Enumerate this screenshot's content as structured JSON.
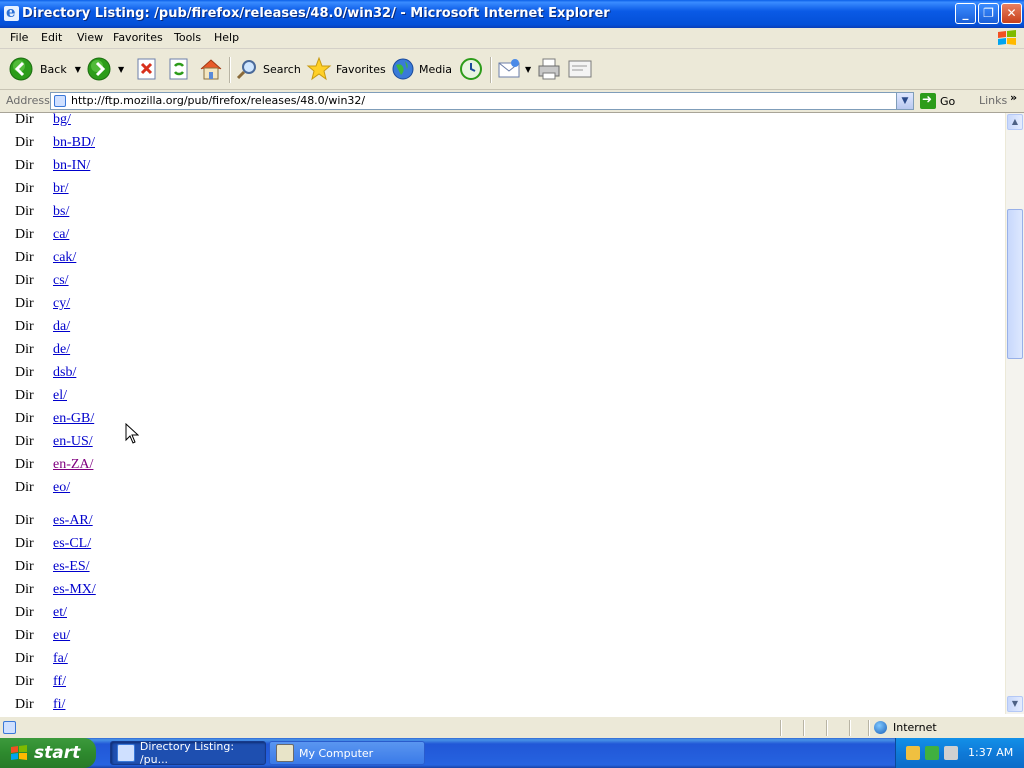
{
  "window": {
    "title": "Directory Listing: /pub/firefox/releases/48.0/win32/ - Microsoft Internet Explorer",
    "minimize_glyph": "_",
    "maximize_glyph": "❐",
    "close_glyph": "✕"
  },
  "menu": {
    "items": [
      "File",
      "Edit",
      "View",
      "Favorites",
      "Tools",
      "Help"
    ]
  },
  "toolbar": {
    "back_label": "Back",
    "search_label": "Search",
    "favorites_label": "Favorites",
    "media_label": "Media"
  },
  "address": {
    "label": "Address",
    "url": "http://ftp.mozilla.org/pub/firefox/releases/48.0/win32/",
    "go_label": "Go",
    "links_label": "Links",
    "links_chevron": "»"
  },
  "listing": {
    "rows": [
      {
        "type": "Dir",
        "name": "bg/",
        "visited": false
      },
      {
        "type": "Dir",
        "name": "bn-BD/",
        "visited": false
      },
      {
        "type": "Dir",
        "name": "bn-IN/",
        "visited": false
      },
      {
        "type": "Dir",
        "name": "br/",
        "visited": false
      },
      {
        "type": "Dir",
        "name": "bs/",
        "visited": false
      },
      {
        "type": "Dir",
        "name": "ca/",
        "visited": false
      },
      {
        "type": "Dir",
        "name": "cak/",
        "visited": false
      },
      {
        "type": "Dir",
        "name": "cs/",
        "visited": false
      },
      {
        "type": "Dir",
        "name": "cy/",
        "visited": false
      },
      {
        "type": "Dir",
        "name": "da/",
        "visited": false
      },
      {
        "type": "Dir",
        "name": "de/",
        "visited": false
      },
      {
        "type": "Dir",
        "name": "dsb/",
        "visited": false
      },
      {
        "type": "Dir",
        "name": "el/",
        "visited": false
      },
      {
        "type": "Dir",
        "name": "en-GB/",
        "visited": false
      },
      {
        "type": "Dir",
        "name": "en-US/",
        "visited": false
      },
      {
        "type": "Dir",
        "name": "en-ZA/",
        "visited": true
      },
      {
        "type": "Dir",
        "name": "eo/",
        "visited": false
      },
      {
        "type": "Dir",
        "name": "es-AR/",
        "visited": false
      },
      {
        "type": "Dir",
        "name": "es-CL/",
        "visited": false
      },
      {
        "type": "Dir",
        "name": "es-ES/",
        "visited": false
      },
      {
        "type": "Dir",
        "name": "es-MX/",
        "visited": false
      },
      {
        "type": "Dir",
        "name": "et/",
        "visited": false
      },
      {
        "type": "Dir",
        "name": "eu/",
        "visited": false
      },
      {
        "type": "Dir",
        "name": "fa/",
        "visited": false
      },
      {
        "type": "Dir",
        "name": "ff/",
        "visited": false
      },
      {
        "type": "Dir",
        "name": "fi/",
        "visited": false
      }
    ]
  },
  "scrollbar": {
    "up_glyph": "▲",
    "down_glyph": "▼"
  },
  "status": {
    "zone_label": "Internet"
  },
  "taskbar": {
    "start_label": "start",
    "tasks": [
      {
        "label": "Directory Listing: /pu...",
        "active": true
      },
      {
        "label": "My Computer",
        "active": false
      }
    ],
    "clock": "1:37 AM"
  }
}
